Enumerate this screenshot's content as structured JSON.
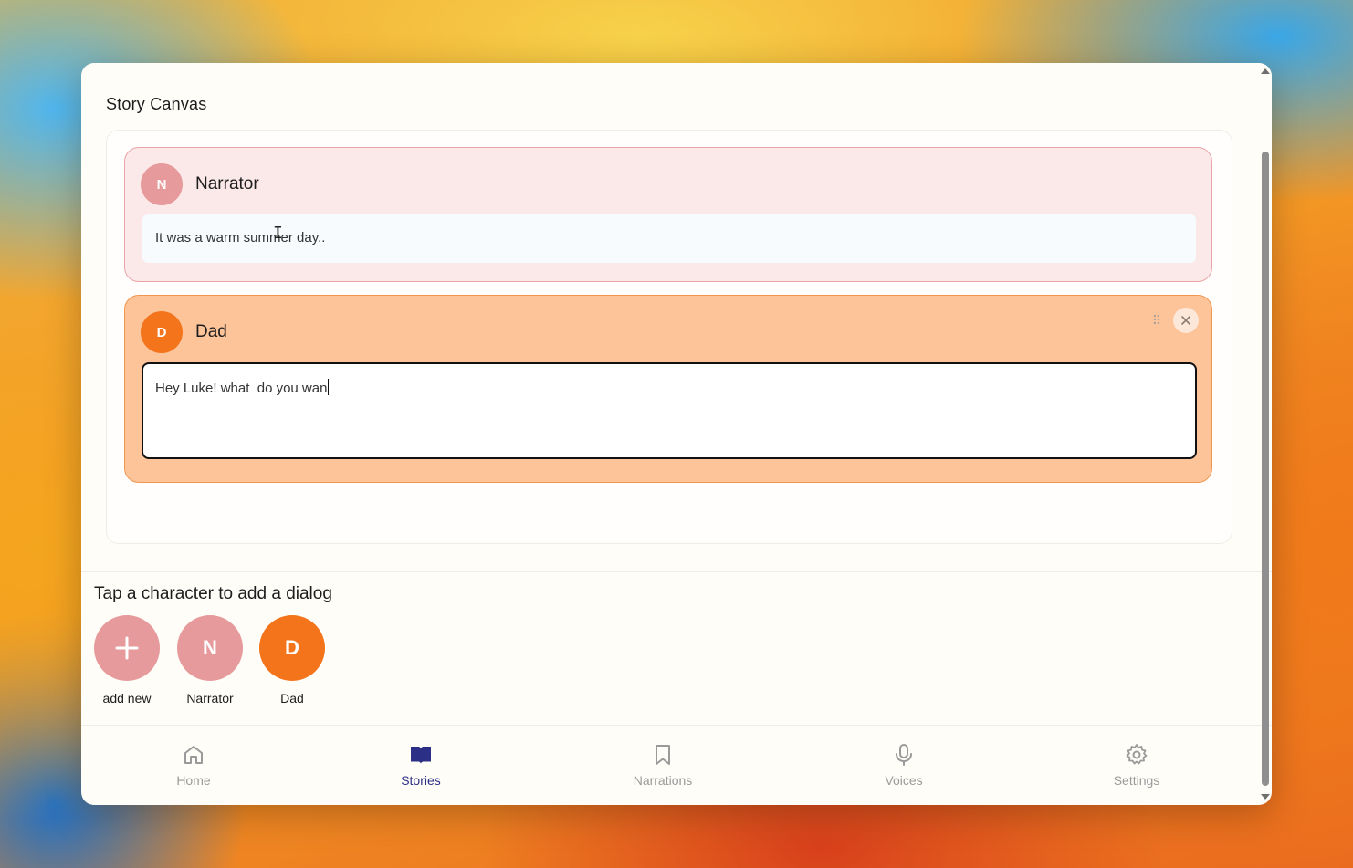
{
  "page": {
    "title": "Story Canvas"
  },
  "dialogs": [
    {
      "initial": "N",
      "name": "Narrator",
      "text": "It was a warm summer day..",
      "color": "#e79a9b"
    },
    {
      "initial": "D",
      "name": "Dad",
      "text": "Hey Luke! what  do you wan",
      "color": "#f3741a",
      "editing": true
    }
  ],
  "character_picker": {
    "hint": "Tap a character to add a dialog",
    "items": [
      {
        "symbol": "+",
        "label": "add new"
      },
      {
        "symbol": "N",
        "label": "Narrator"
      },
      {
        "symbol": "D",
        "label": "Dad"
      }
    ]
  },
  "nav": {
    "items": [
      {
        "label": "Home",
        "icon": "home-icon"
      },
      {
        "label": "Stories",
        "icon": "book-icon",
        "active": true
      },
      {
        "label": "Narrations",
        "icon": "bookmark-icon"
      },
      {
        "label": "Voices",
        "icon": "microphone-icon"
      },
      {
        "label": "Settings",
        "icon": "gear-icon"
      }
    ],
    "active_color": "#2c2f86",
    "inactive_color": "#9a9a9a"
  }
}
